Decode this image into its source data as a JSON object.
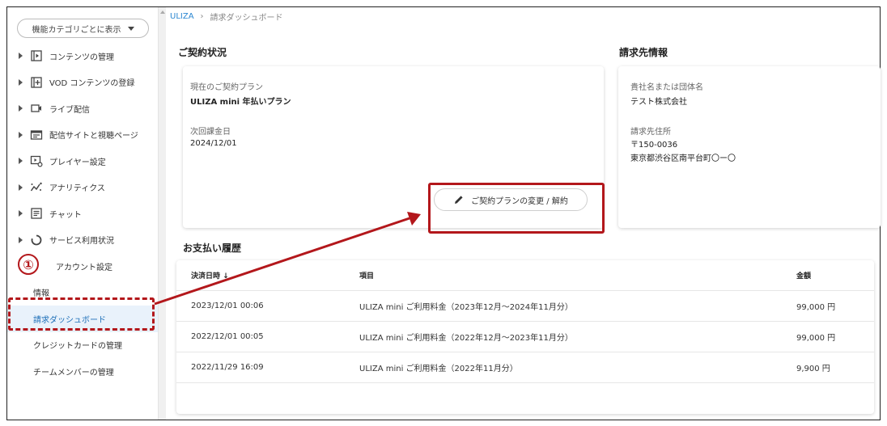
{
  "sidebar": {
    "category_button": "機能カテゴリごとに表示",
    "items": [
      {
        "label": "コンテンツの管理",
        "icon": "content-icon"
      },
      {
        "label": "VOD コンテンツの登録",
        "icon": "upload-icon"
      },
      {
        "label": "ライブ配信",
        "icon": "live-icon"
      },
      {
        "label": "配信サイトと視聴ページ",
        "icon": "site-icon"
      },
      {
        "label": "プレイヤー設定",
        "icon": "player-settings-icon"
      },
      {
        "label": "アナリティクス",
        "icon": "analytics-icon"
      },
      {
        "label": "チャット",
        "icon": "chat-icon"
      },
      {
        "label": "サービス利用状況",
        "icon": "usage-icon"
      }
    ],
    "account_label": "アカウント設定",
    "sub_items": [
      "情報",
      "請求ダッシュボード",
      "クレジットカードの管理",
      "チームメンバーの管理"
    ]
  },
  "breadcrumb": {
    "root": "ULIZA",
    "sep": "›",
    "current": "請求ダッシュボード"
  },
  "contract": {
    "title": "ご契約状況",
    "plan_label": "現在のご契約プラン",
    "plan_value": "ULIZA mini 年払いプラン",
    "next_billing_label": "次回課金日",
    "next_billing_value": "2024/12/01",
    "change_button": "ご契約プランの変更 / 解約"
  },
  "billing": {
    "title": "請求先情報",
    "company_label": "貴社名または団体名",
    "company_value": "テスト株式会社",
    "address_label": "請求先住所",
    "postal": "〒150-0036",
    "address": "東京都渋谷区南平台町〇ー〇"
  },
  "payments": {
    "title": "お支払い履歴",
    "headers": [
      "決済日時 ↓",
      "項目",
      "金額"
    ],
    "rows": [
      {
        "date": "2023/12/01 00:06",
        "item": "ULIZA mini ご利用料金（2023年12月～2024年11月分）",
        "amount": "99,000 円"
      },
      {
        "date": "2022/12/01 00:05",
        "item": "ULIZA mini ご利用料金（2022年12月～2023年11月分）",
        "amount": "99,000 円"
      },
      {
        "date": "2022/11/29 16:09",
        "item": "ULIZA mini ご利用料金（2022年11月分）",
        "amount": "9,900 円"
      }
    ]
  },
  "annotation": {
    "step": "①",
    "color": "#b3171b"
  }
}
